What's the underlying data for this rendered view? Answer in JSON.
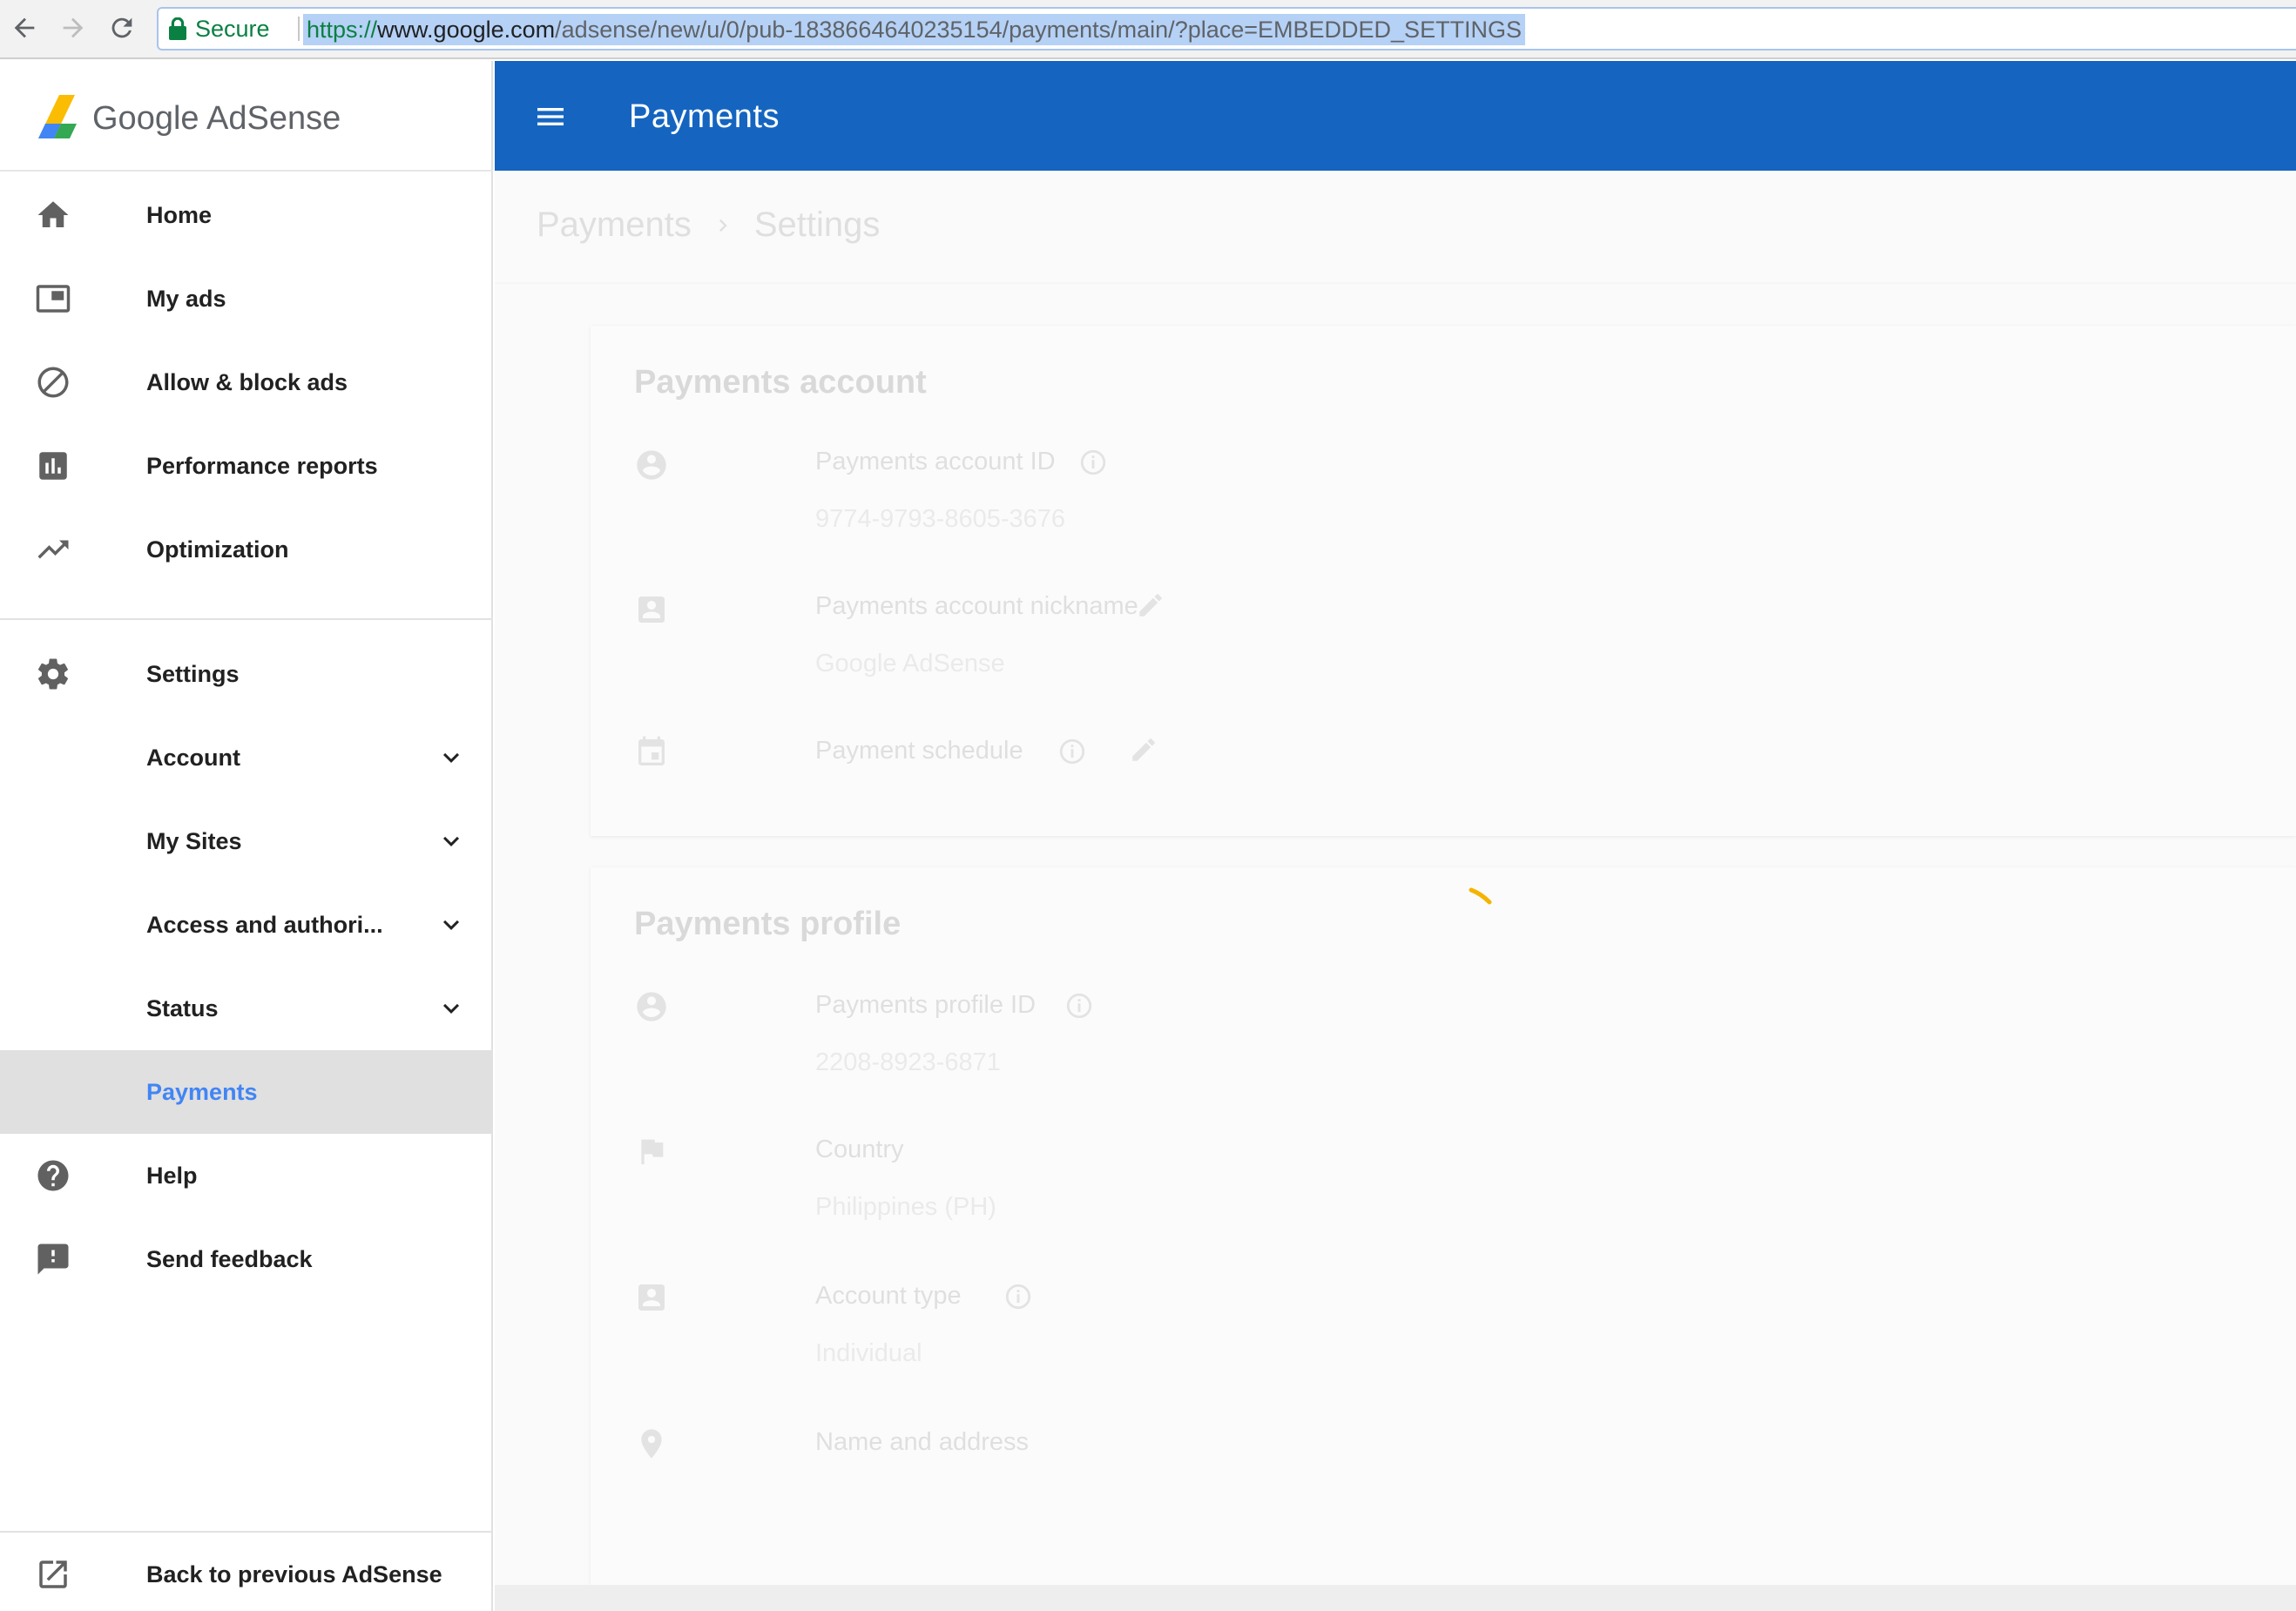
{
  "browser": {
    "secure_label": "Secure",
    "url_scheme": "https://",
    "url_host": "www.google.com",
    "url_path": "/adsense/new/u/0/pub-1838664640235154/payments/main/?place=EMBEDDED_SETTINGS"
  },
  "brand": {
    "google": "Google",
    "product": "AdSense"
  },
  "appbar": {
    "title": "Payments"
  },
  "sidebar": {
    "items": [
      {
        "label": "Home",
        "icon": "home-icon"
      },
      {
        "label": "My ads",
        "icon": "ads-icon"
      },
      {
        "label": "Allow & block ads",
        "icon": "block-icon"
      },
      {
        "label": "Performance reports",
        "icon": "bar-chart-icon"
      },
      {
        "label": "Optimization",
        "icon": "trending-up-icon"
      },
      {
        "label": "Settings",
        "icon": "gear-icon"
      },
      {
        "label": "Account",
        "icon": "chevron-down-icon"
      },
      {
        "label": "My Sites",
        "icon": "chevron-down-icon"
      },
      {
        "label": "Access and authori...",
        "icon": "chevron-down-icon"
      },
      {
        "label": "Status",
        "icon": "chevron-down-icon"
      },
      {
        "label": "Payments",
        "active": true
      },
      {
        "label": "Help",
        "icon": "help-icon"
      },
      {
        "label": "Send feedback",
        "icon": "feedback-icon"
      }
    ],
    "footer": {
      "label": "Back to previous AdSense",
      "icon": "open-external-icon"
    }
  },
  "breadcrumb": {
    "root": "Payments",
    "current": "Settings"
  },
  "payments_account": {
    "title": "Payments account",
    "id_label": "Payments account ID",
    "id_value": "9774-9793-8605-3676",
    "nickname_label": "Payments account nickname",
    "nickname_value": "Google AdSense",
    "schedule_label": "Payment schedule"
  },
  "payments_profile": {
    "title": "Payments profile",
    "id_label": "Payments profile ID",
    "id_value": "2208-8923-6871",
    "country_label": "Country",
    "country_value": "Philippines (PH)",
    "account_type_label": "Account type",
    "account_type_value": "Individual",
    "contact_label": "Name and address"
  },
  "colors": {
    "appbar": "#1565c0",
    "active_link": "#4285f4",
    "active_bg": "#e0e0e0",
    "secure": "#0b8043",
    "spinner": "#f4b400"
  }
}
